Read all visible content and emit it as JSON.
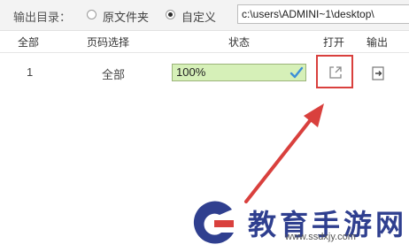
{
  "toolbar": {
    "output_dir_label": "输出目录：",
    "radio_original": "原文件夹",
    "radio_custom": "自定义",
    "selected": "自定义",
    "path_value": "c:\\users\\ADMINI~1\\desktop\\"
  },
  "table": {
    "headers": [
      "全部",
      "页码选择",
      "状态",
      "打开",
      "输出"
    ],
    "rows": [
      {
        "index": "1",
        "pages": "全部",
        "status": "100%",
        "progress": 1.0
      }
    ]
  },
  "watermark": {
    "brand": "教育手游网",
    "url": "www.ssdxjy.com"
  },
  "colors": {
    "progress_bg": "#d6f0b8",
    "highlight": "#d9403d",
    "brand": "#2f3f8f"
  },
  "icons": [
    "check-icon",
    "open-external-icon",
    "export-icon"
  ]
}
